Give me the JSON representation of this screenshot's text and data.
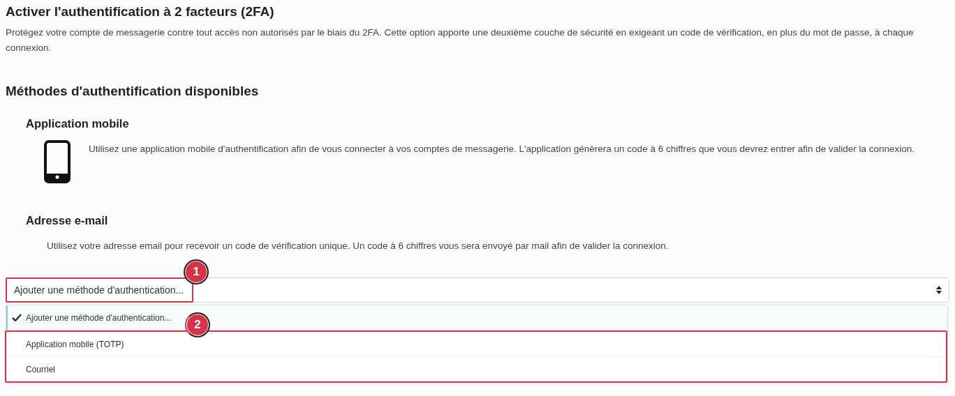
{
  "title": "Activer l'authentification à 2 facteurs (2FA)",
  "intro": "Protégez votre compte de messagerie contre tout accès non autorisés par le biais du 2FA. Cette option apporte une deuxième couche de sécurité en exigeant un code de vérification, en plus du mot de passe, à chaque connexion.",
  "methods_heading": "Méthodes d'authentification disponibles",
  "methods": [
    {
      "kind": "mobile",
      "title": "Application mobile",
      "description": "Utilisez une application mobile d'authentification afin de vous connecter à vos comptes de messagerie. L'application génèrera un code à 6 chiffres que vous devrez entrer afin de valider la connexion."
    },
    {
      "kind": "email",
      "title": "Adresse e-mail",
      "description": "Utilisez votre adresse email pour recevoir un code de vérification unique. Un code à 6 chiffres vous sera envoyé par mail afin de valider la connexion."
    }
  ],
  "select": {
    "value": "Ajouter une méthode d'authentication...",
    "expanded": true
  },
  "options": [
    {
      "label": "Ajouter une méthode d'authentication...",
      "selected": true
    },
    {
      "label": "Application mobile (TOTP)",
      "selected": false
    },
    {
      "label": "Courriel",
      "selected": false
    }
  ],
  "annotations": [
    {
      "label": "1",
      "kind": "select"
    },
    {
      "label": "2",
      "kind": "options"
    }
  ]
}
